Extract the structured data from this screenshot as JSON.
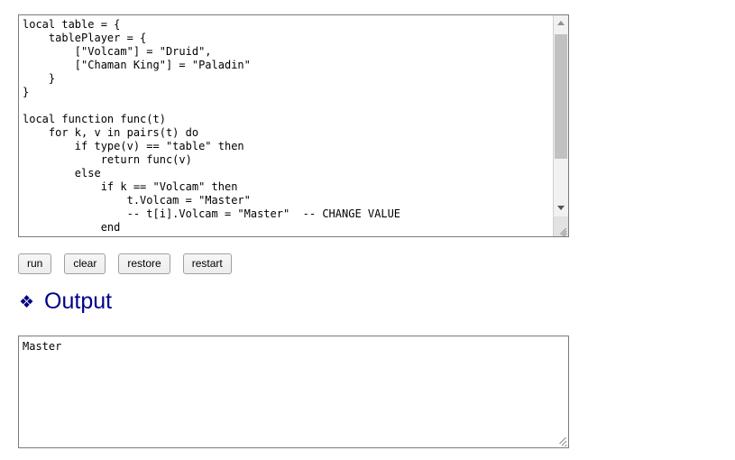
{
  "editor": {
    "name": "lua-code-editor",
    "code": "local table = {\n    tablePlayer = {\n        [\"Volcam\"] = \"Druid\",\n        [\"Chaman King\"] = \"Paladin\"\n    }\n}\n\nlocal function func(t)\n    for k, v in pairs(t) do\n        if type(v) == \"table\" then\n            return func(v)\n        else\n            if k == \"Volcam\" then\n                t.Volcam = \"Master\"\n                -- t[i].Volcam = \"Master\"  -- CHANGE VALUE\n            end",
    "scrollbar": {
      "up_arrow_icon": "triangle-up-icon",
      "down_arrow_icon": "triangle-down-icon",
      "thumb": "scrollbar-thumb",
      "resize_grip_icon": "resize-grip-icon"
    }
  },
  "toolbar": {
    "buttons": [
      {
        "label": "run",
        "name": "run-button"
      },
      {
        "label": "clear",
        "name": "clear-button"
      },
      {
        "label": "restore",
        "name": "restore-button"
      },
      {
        "label": "restart",
        "name": "restart-button"
      }
    ]
  },
  "output_section": {
    "bullet_icon": "❖",
    "bullet_icon_name": "diamond-bullet-icon",
    "title": "Output",
    "text": "Master",
    "resize_grip_icon": "resize-grip-icon"
  },
  "colors": {
    "heading": "#00008b",
    "bullet": "#000080",
    "border": "#7b7b7b",
    "scrollbar_thumb": "#c1c1c1",
    "button_bg": "#ededed"
  }
}
